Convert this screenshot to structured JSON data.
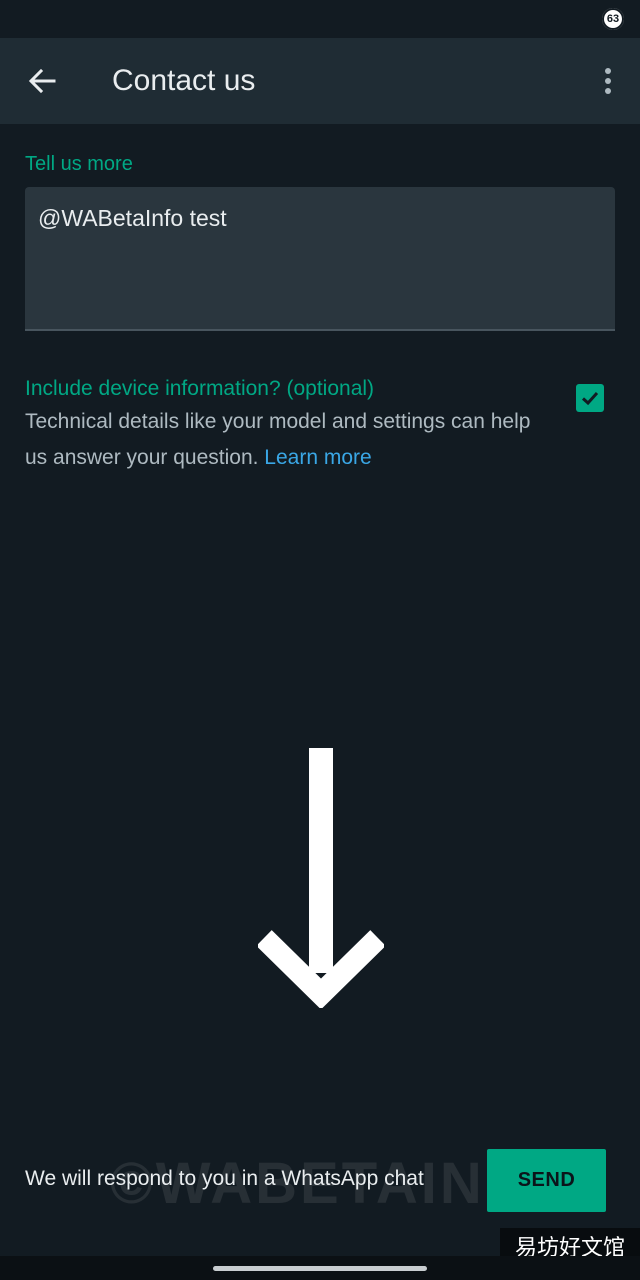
{
  "status_bar": {
    "battery_level": "63"
  },
  "app_bar": {
    "title": "Contact us"
  },
  "form": {
    "label": "Tell us more",
    "message": "@WABetaInfo test"
  },
  "device_info": {
    "title": "Include device information? (optional)",
    "description": "Technical details like your model and settings can help us answer your question. ",
    "learn_more": "Learn more",
    "checked": true
  },
  "footer": {
    "note": "We will respond to you in a WhatsApp chat",
    "send_label": "SEND"
  },
  "watermark": {
    "text": "©WABETAINFO"
  },
  "corner_brand": {
    "text": "易坊好文馆"
  },
  "colors": {
    "accent": "#00a884",
    "link": "#3aa7e6",
    "background": "#121b22",
    "app_bar": "#1f2c34"
  }
}
